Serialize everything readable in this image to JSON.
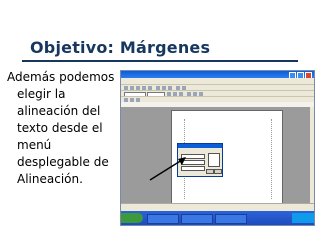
{
  "slide": {
    "title": "Objetivo: Márgenes",
    "body_first_line": "Además podemos",
    "body_rest": "elegir la alineación del texto desde el menú desplegable de Alineación."
  },
  "colors": {
    "title": "#17375e",
    "rule": "#17375e",
    "arrow": "#000000"
  }
}
